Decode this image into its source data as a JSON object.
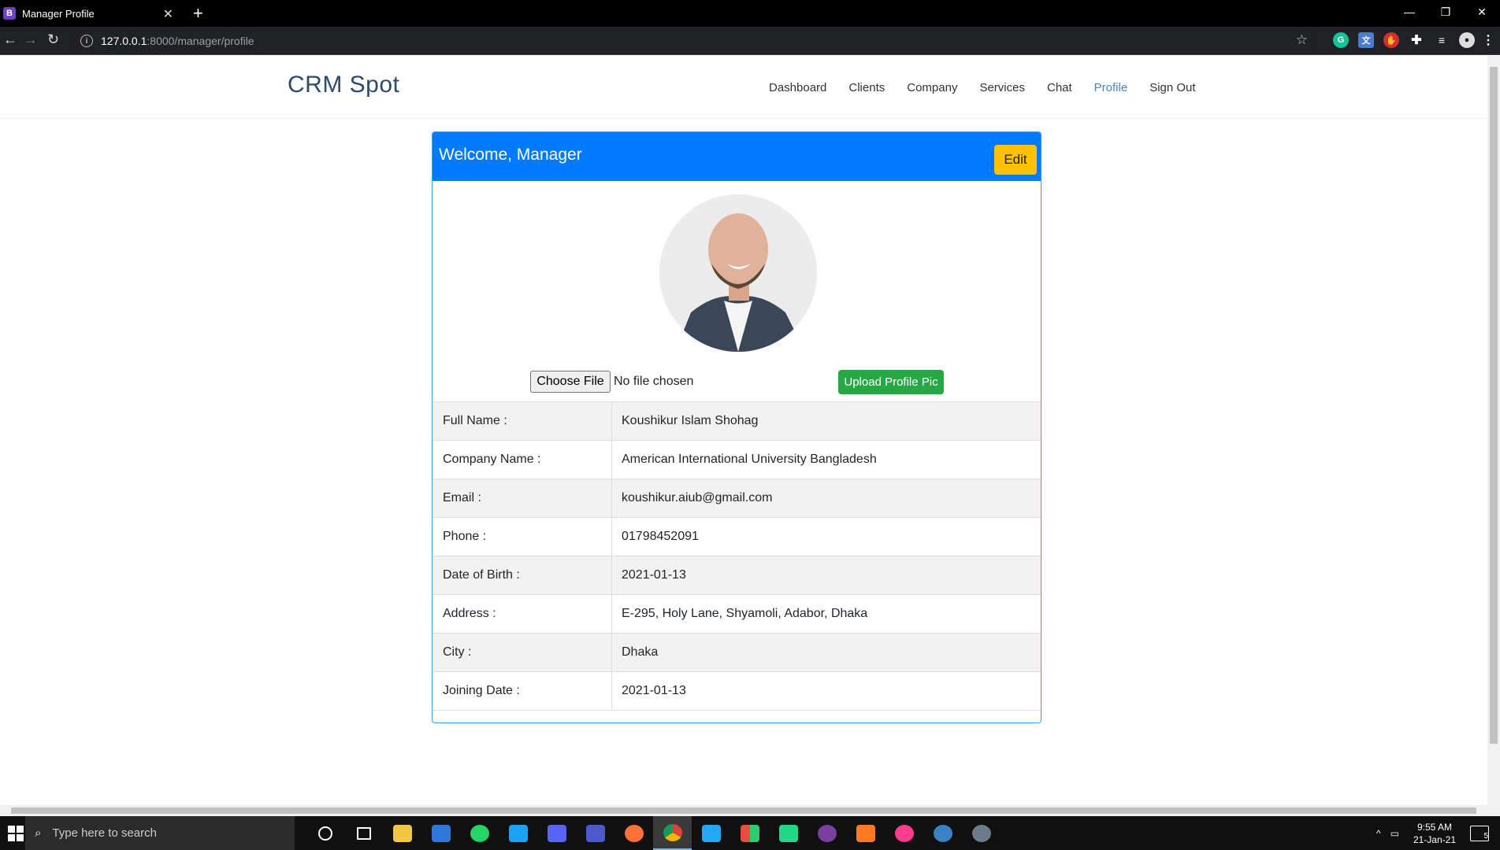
{
  "browser": {
    "tab_title": "Manager Profile",
    "tab_favicon": "B",
    "url_host": "127.0.0.1",
    "url_rest": ":8000/manager/profile"
  },
  "nav": {
    "brand": "CRM Spot",
    "links": [
      "Dashboard",
      "Clients",
      "Company",
      "Services",
      "Chat",
      "Profile",
      "Sign Out"
    ],
    "active": "Profile"
  },
  "card": {
    "title": "Welcome, Manager",
    "edit_label": "Edit",
    "choose_file_label": "Choose File",
    "no_file_text": "No file chosen",
    "upload_label": "Upload Profile Pic"
  },
  "profile": [
    {
      "label": "Full Name :",
      "value": "Koushikur Islam Shohag"
    },
    {
      "label": "Company Name :",
      "value": "American International University Bangladesh"
    },
    {
      "label": "Email :",
      "value": "koushikur.aiub@gmail.com"
    },
    {
      "label": "Phone :",
      "value": "01798452091"
    },
    {
      "label": "Date of Birth :",
      "value": "2021-01-13"
    },
    {
      "label": "Address :",
      "value": "E-295, Holy Lane, Shyamoli, Adabor, Dhaka"
    },
    {
      "label": "City :",
      "value": "Dhaka"
    },
    {
      "label": "Joining Date :",
      "value": "2021-01-13"
    }
  ],
  "taskbar": {
    "search_placeholder": "Type here to search",
    "time": "9:55 AM",
    "date": "21-Jan-21",
    "notification_count": "5"
  },
  "colors": {
    "header_blue": "#007bff",
    "edit_yellow": "#ffc107",
    "upload_green": "#28a745",
    "card_border": "#3ca5d6",
    "brand_text": "#2c4a6a"
  }
}
